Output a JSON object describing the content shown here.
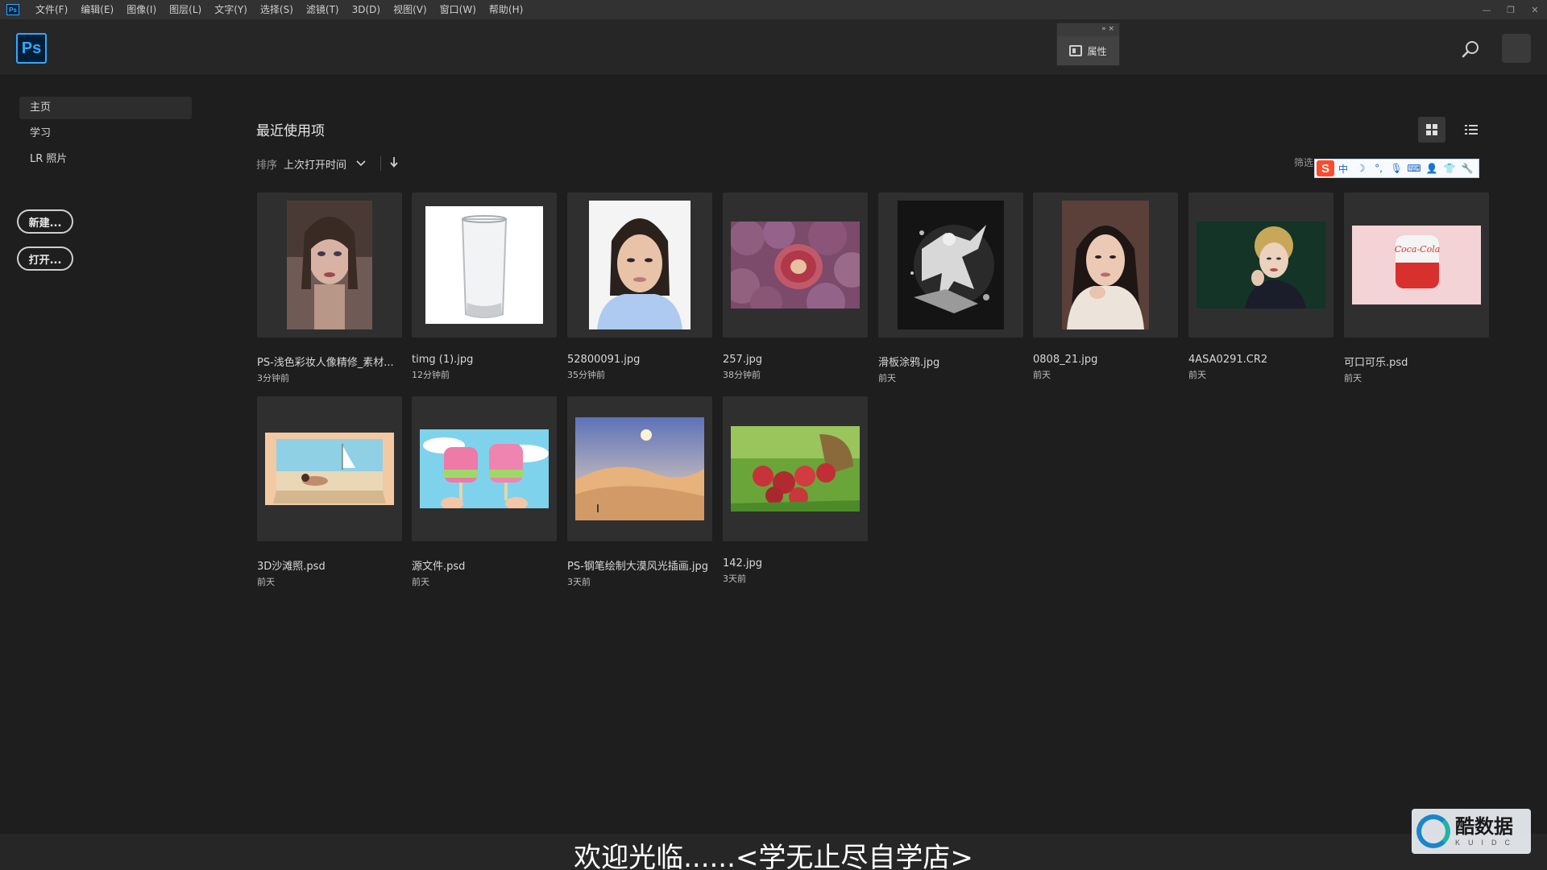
{
  "menubar": {
    "app_icon": "Ps",
    "items": [
      "文件(F)",
      "编辑(E)",
      "图像(I)",
      "图层(L)",
      "文字(Y)",
      "选择(S)",
      "滤镜(T)",
      "3D(D)",
      "视图(V)",
      "窗口(W)",
      "帮助(H)"
    ],
    "window_controls": [
      "minimize-icon",
      "restore-icon",
      "close-icon"
    ]
  },
  "header": {
    "logo": "Ps",
    "properties_panel": {
      "label": "属性",
      "controls": "»  ×"
    }
  },
  "sidebar": {
    "items": [
      "主页",
      "学习",
      "LR 照片"
    ],
    "active": "主页",
    "new_button": "新建...",
    "open_button": "打开..."
  },
  "main": {
    "title": "最近使用项",
    "sort_label": "排序",
    "sort_value": "上次打开时间",
    "filter_label": "筛选",
    "ime_bar": {
      "logo": "S",
      "items": [
        "中",
        "☽",
        "°,",
        "🎙",
        "⌨",
        "👤",
        "👕",
        "🔧"
      ]
    },
    "files": [
      {
        "name": "PS-浅色彩妆人像精修_素材...",
        "age": "3分钟前"
      },
      {
        "name": "timg (1).jpg",
        "age": "12分钟前"
      },
      {
        "name": "52800091.jpg",
        "age": "35分钟前"
      },
      {
        "name": "257.jpg",
        "age": "38分钟前"
      },
      {
        "name": "滑板涂鸦.jpg",
        "age": "前天"
      },
      {
        "name": "0808_21.jpg",
        "age": "前天"
      },
      {
        "name": "4ASA0291.CR2",
        "age": "前天"
      },
      {
        "name": "可口可乐.psd",
        "age": "前天"
      },
      {
        "name": "3D沙滩照.psd",
        "age": "前天"
      },
      {
        "name": "源文件.psd",
        "age": "前天"
      },
      {
        "name": "PS-钢笔绘制大漠风光插画.jpg",
        "age": "3天前"
      },
      {
        "name": "142.jpg",
        "age": "3天前"
      }
    ]
  },
  "caption": "欢迎光临......<学无止尽自学店>",
  "watermark": {
    "cn": "酷数据",
    "en": "KUIDC"
  }
}
